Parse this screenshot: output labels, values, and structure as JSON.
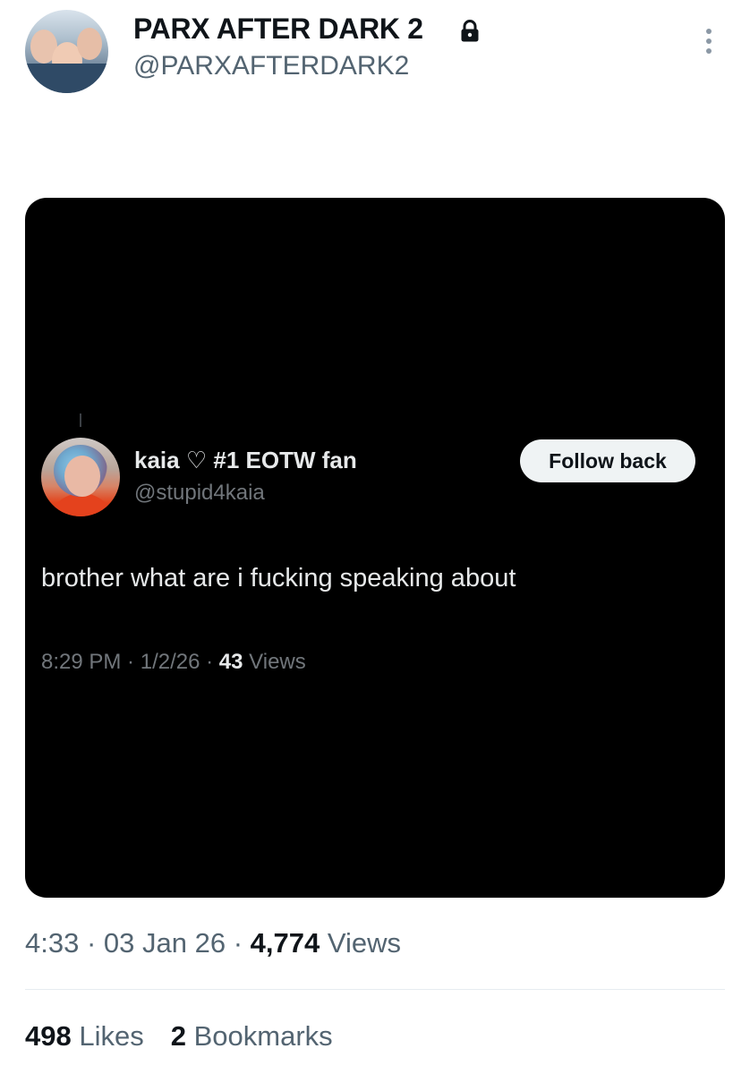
{
  "author": {
    "display_name": "PARX AFTER DARK 2",
    "handle": "@PARXAFTERDARK2",
    "protected_icon": "lock-icon"
  },
  "menu_icon": "more-vertical-icon",
  "embedded_post": {
    "display_name": "kaia",
    "heart": "♡",
    "name_suffix": "#1 EOTW fan",
    "handle": "@stupid4kaia",
    "follow_label": "Follow back",
    "text": "brother what are i fucking speaking about",
    "time": "8:29 PM",
    "date": "1/2/26",
    "views_count": "43",
    "views_label": "Views"
  },
  "post_meta": {
    "time": "4:33",
    "date": "03 Jan 26",
    "views_count": "4,774",
    "views_label": "Views"
  },
  "stats": {
    "likes_count": "498",
    "likes_label": "Likes",
    "bookmarks_count": "2",
    "bookmarks_label": "Bookmarks"
  },
  "colors": {
    "text_primary": "#0f1419",
    "text_secondary": "#536471",
    "media_background": "#000000",
    "follow_button": "#eff3f4"
  }
}
